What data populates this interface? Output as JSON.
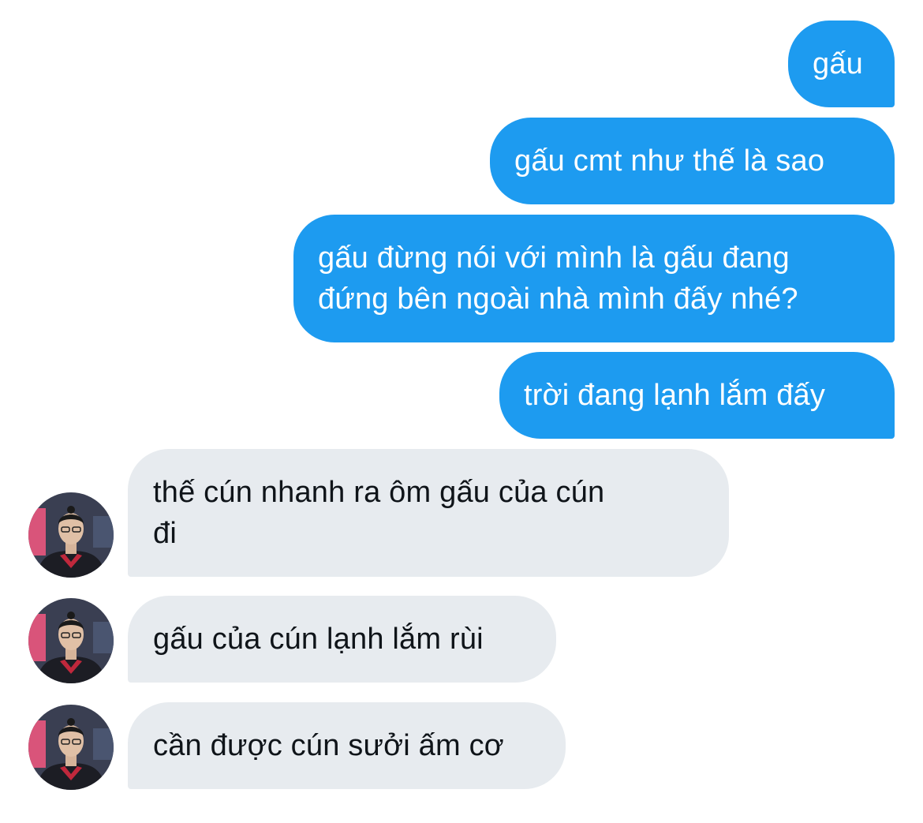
{
  "conversation": {
    "sent_messages": [
      {
        "text": "gấu"
      },
      {
        "text": "gấu cmt như thế là sao"
      },
      {
        "text": "gấu đừng nói với mình là gấu đang\nđứng bên ngoài nhà mình đấy nhé?"
      },
      {
        "text": "trời đang lạnh lắm đấy"
      }
    ],
    "received_messages": [
      {
        "text": "thế cún nhanh ra ôm gấu của cún\nđi"
      },
      {
        "text": "gấu của cún lạnh lắm rùi"
      },
      {
        "text": "cần được cún sưởi ấm cơ"
      }
    ],
    "colors": {
      "sent_bubble": "#1d9bf0",
      "received_bubble": "#e7ebef",
      "sent_text": "#ffffff",
      "received_text": "#0f1419"
    },
    "avatar_icon": "contact-avatar-photo"
  }
}
